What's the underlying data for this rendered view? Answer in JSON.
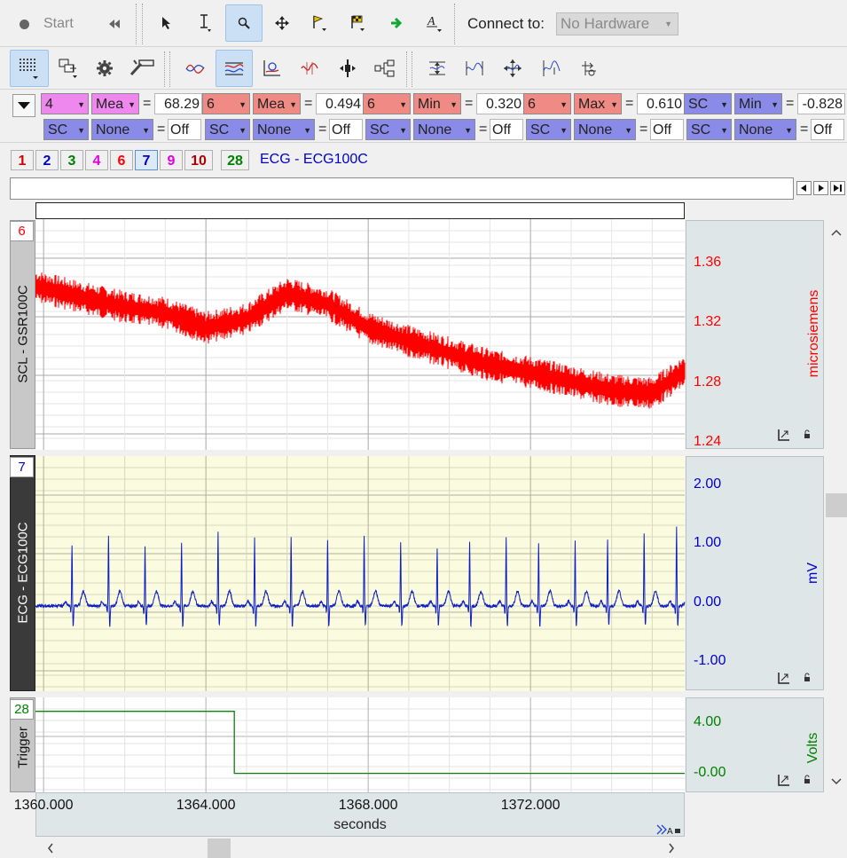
{
  "toolbar1": {
    "start_label": "Start",
    "connect_label": "Connect to:",
    "hardware_value": "No Hardware"
  },
  "measurements": {
    "row1": [
      {
        "channel": "4",
        "func": "Mea",
        "value": "68.29",
        "color": "#ee88ee"
      },
      {
        "channel": "6",
        "func": "Mea",
        "value": "0.494",
        "color": "#f08a84"
      },
      {
        "channel": "6",
        "func": "Min",
        "value": "0.320",
        "color": "#f08a84"
      },
      {
        "channel": "6",
        "func": "Max",
        "value": "0.610",
        "color": "#f08a84"
      },
      {
        "channel": "SC",
        "func": "Min",
        "value": "-0.828",
        "color": "#8a8ae8"
      }
    ],
    "row2": [
      {
        "channel": "SC",
        "func": "None",
        "value": "Off"
      },
      {
        "channel": "SC",
        "func": "None",
        "value": "Off"
      },
      {
        "channel": "SC",
        "func": "None",
        "value": "Off"
      },
      {
        "channel": "SC",
        "func": "None",
        "value": "Off"
      },
      {
        "channel": "SC",
        "func": "None",
        "value": "Off"
      }
    ],
    "eq": "="
  },
  "channel_tabs": [
    {
      "label": "1",
      "color": "#d00000"
    },
    {
      "label": "2",
      "color": "#0000cc"
    },
    {
      "label": "3",
      "color": "#008000"
    },
    {
      "label": "4",
      "color": "#e000e0"
    },
    {
      "label": "6",
      "color": "#ff0000"
    },
    {
      "label": "7",
      "color": "#0000cc"
    },
    {
      "label": "9",
      "color": "#e000e0"
    },
    {
      "label": "10",
      "color": "#b00000"
    },
    {
      "label": "28",
      "color": "#008000"
    }
  ],
  "active_channel_label": "ECG - ECG100C",
  "panels": {
    "scl": {
      "number": "6",
      "name": "SCL - GSR100C",
      "unit": "microsiemens",
      "color": "#ff0000",
      "ticks": [
        "1.36",
        "1.32",
        "1.28",
        "1.24"
      ]
    },
    "ecg": {
      "number": "7",
      "name": "ECG - ECG100C",
      "unit": "mV",
      "color": "#0000cc",
      "ticks": [
        "2.00",
        "1.00",
        "0.00",
        "-1.00"
      ]
    },
    "trig": {
      "number": "28",
      "name": "Trigger",
      "unit": "Volts",
      "color": "#008000",
      "ticks": [
        "4.00",
        "-0.00"
      ]
    }
  },
  "xaxis": {
    "ticks": [
      "1360.000",
      "1364.000",
      "1368.000",
      "1372.000"
    ],
    "label": "seconds"
  },
  "chart_data": {
    "type": "line",
    "xlabel": "seconds",
    "xlim": [
      1359.8,
      1375.8
    ],
    "series": [
      {
        "name": "SCL - GSR100C",
        "unit": "microsiemens",
        "ylim": [
          1.235,
          1.39
        ],
        "x": [
          1359.8,
          1361,
          1362,
          1363,
          1364,
          1365,
          1366,
          1367,
          1368,
          1369,
          1370,
          1371,
          1372,
          1373,
          1374,
          1375,
          1375.8
        ],
        "y": [
          1.345,
          1.337,
          1.331,
          1.327,
          1.317,
          1.323,
          1.34,
          1.333,
          1.317,
          1.308,
          1.3,
          1.292,
          1.287,
          1.281,
          1.275,
          1.273,
          1.288
        ]
      },
      {
        "name": "ECG - ECG100C",
        "unit": "mV",
        "ylim": [
          -1.5,
          2.5
        ],
        "beats_at": [
          1360.7,
          1361.6,
          1362.5,
          1363.4,
          1364.3,
          1365.2,
          1366.1,
          1367.0,
          1367.9,
          1368.8,
          1369.7,
          1370.5,
          1371.4,
          1372.2,
          1373.1,
          1373.9,
          1374.8,
          1375.6
        ],
        "r_peak_mV": [
          1.05,
          1.2,
          1.0,
          1.1,
          1.25,
          1.15,
          1.2,
          1.15,
          1.2,
          1.1,
          1.0,
          1.1,
          1.15,
          1.05,
          1.1,
          1.15,
          1.25,
          1.35
        ]
      },
      {
        "name": "Trigger",
        "unit": "Volts",
        "ylim": [
          -1.5,
          6.0
        ],
        "x": [
          1359.8,
          1364.7,
          1364.7,
          1375.8
        ],
        "y": [
          4.9,
          4.9,
          0.0,
          0.0
        ]
      }
    ]
  }
}
